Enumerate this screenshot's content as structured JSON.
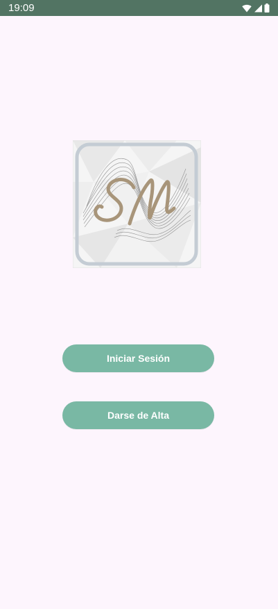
{
  "status_bar": {
    "time": "19:09",
    "icons": [
      "wifi-icon",
      "signal-icon",
      "battery-icon"
    ],
    "background": "#527463"
  },
  "logo": {
    "name": "sm-monogram-logo",
    "monogram_color": "#a8957a",
    "frame_color": "#c4ccd4"
  },
  "actions": {
    "login_label": "Iniciar Sesión",
    "signup_label": "Darse de Alta",
    "button_color": "#79b8a4"
  },
  "theme": {
    "background": "#fdf5fd"
  }
}
